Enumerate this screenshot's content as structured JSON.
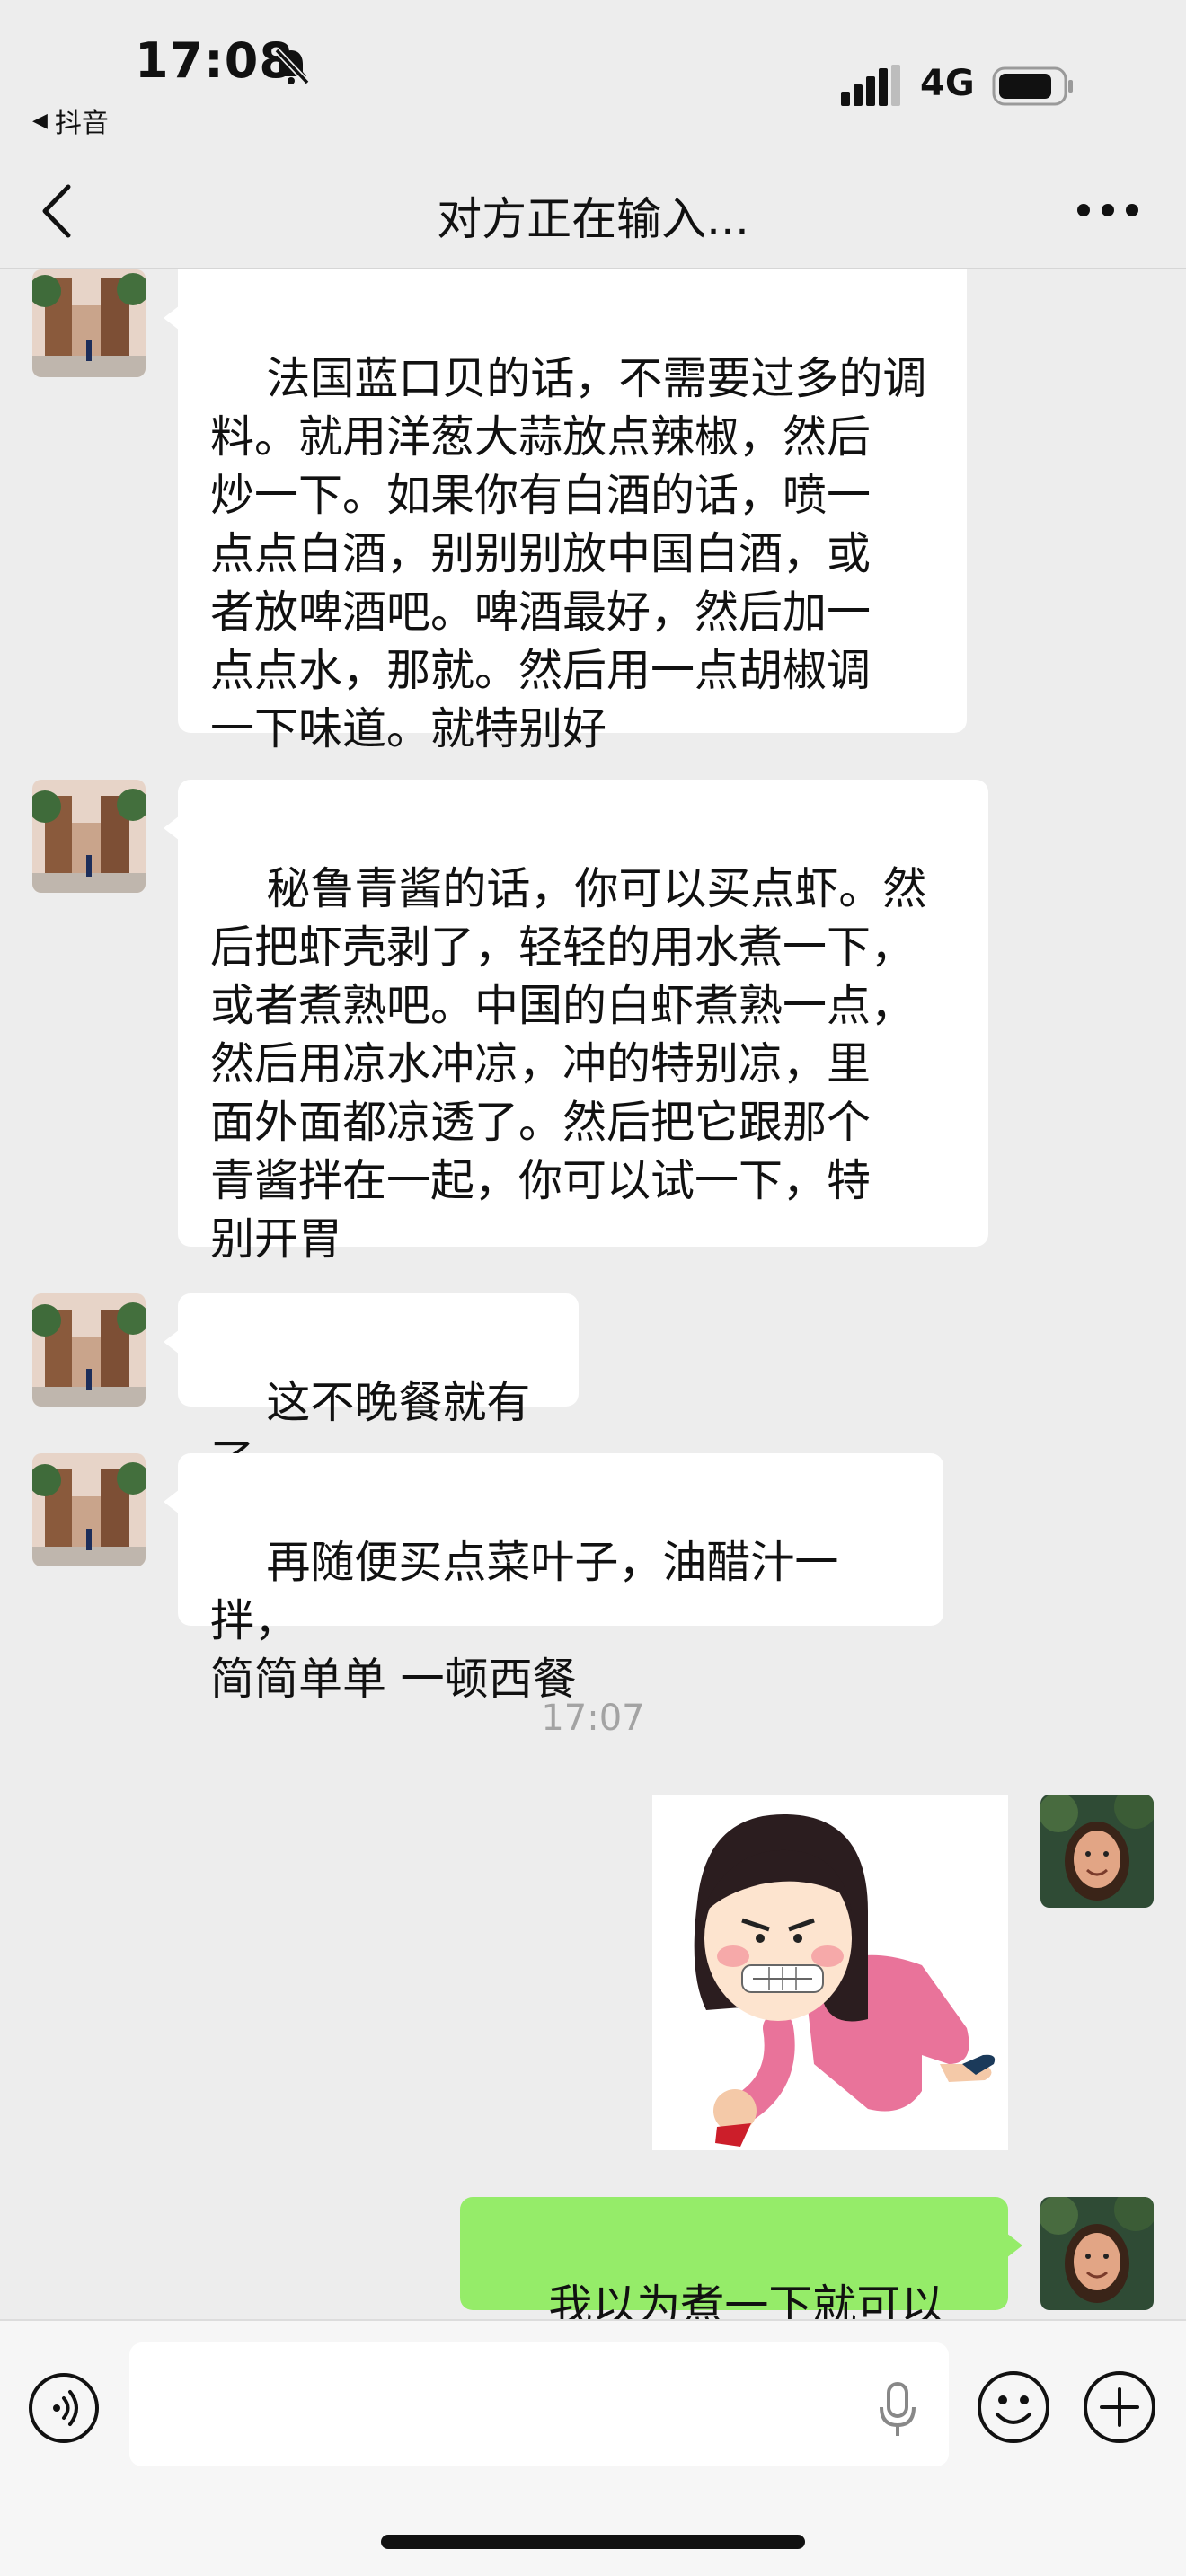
{
  "status_bar": {
    "time": "17:08",
    "back_app_label": "抖音",
    "network": "4G"
  },
  "nav": {
    "title": "对方正在输入..."
  },
  "messages": [
    {
      "text": "法国蓝口贝的话，不需要过多的调\n料。就用洋葱大蒜放点辣椒，然后\n炒一下。如果你有白酒的话，喷一\n点点白酒，别别别放中国白酒，或\n者放啤酒吧。啤酒最好，然后加一\n点点水，那就。然后用一点胡椒调\n一下味道。就特别好"
    },
    {
      "text": "秘鲁青酱的话，你可以买点虾。然\n后把虾壳剥了，轻轻的用水煮一下，\n或者煮熟吧。中国的白虾煮熟一点，\n然后用凉水冲凉，冲的特别凉，里\n面外面都凉透了。然后把它跟那个\n青酱拌在一起，你可以试一下，特\n别开胃"
    },
    {
      "text": "这不晚餐就有了"
    },
    {
      "text": "再随便买点菜叶子，油醋汁一拌，\n简简单单 一顿西餐"
    },
    {
      "timestamp": "17:07"
    },
    {
      "sent_text": "我以为煮一下就可以吃"
    }
  ],
  "colors": {
    "chat_bg": "#ededed",
    "received_bubble": "#ffffff",
    "sent_bubble": "#95ec69",
    "timestamp": "#a3a3a3"
  },
  "input": {
    "value": "",
    "placeholder": ""
  },
  "icons": {
    "voice": "voice-wave-icon",
    "mic": "microphone-icon",
    "emoji": "smiley-icon",
    "more": "plus-circle-icon"
  }
}
